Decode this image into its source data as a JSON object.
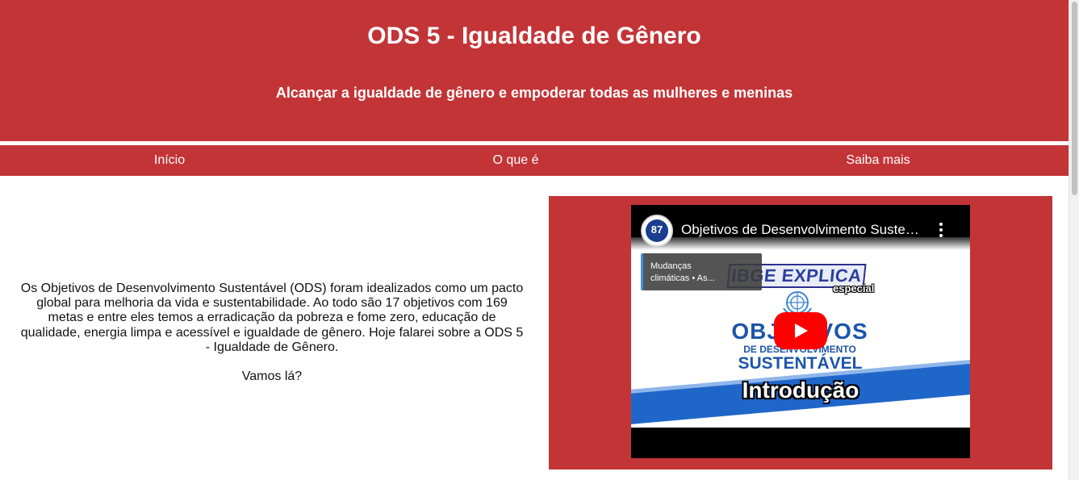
{
  "header": {
    "title": "ODS 5 - Igualdade de Gênero",
    "subtitle": "Alcançar a igualdade de gênero e empoderar todas as mulheres e meninas"
  },
  "nav": {
    "items": [
      {
        "label": "Início"
      },
      {
        "label": "O que é"
      },
      {
        "label": "Saiba mais"
      }
    ]
  },
  "intro": {
    "paragraph": "Os Objetivos de Desenvolvimento Sustentável (ODS) foram idealizados como um pacto global para melhoria da vida e sustentabilidade. Ao todo são 17 objetivos com 169 metas e entre eles temos a erradicação da pobreza e fome zero, educação de qualidade, energia limpa e acessível e igualdade de gênero. Hoje falarei sobre a ODS 5 - Igualdade de Gênero.",
    "closing": "Vamos lá?"
  },
  "video": {
    "title": "Objetivos de Desenvolvimento Sustentável",
    "channel_badge": "87",
    "suggestion_line1": "Mudanças",
    "suggestion_line2": "climáticas • As...",
    "thumbnail": {
      "brand": "IBGE EXPLICA",
      "badge": "especial",
      "word": "OBJETIVOS",
      "line1": "DE DESENVOLVIMENTO",
      "line2": "SUSTENTÁVEL",
      "episode": "Introdução"
    }
  },
  "colors": {
    "brand_red": "#c33437",
    "youtube_red": "#ff0000",
    "ods_blue": "#1d55a8"
  }
}
